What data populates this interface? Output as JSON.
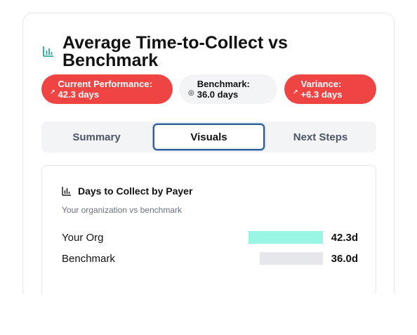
{
  "header": {
    "title": "Average Time-to-Collect vs Benchmark",
    "icon": "bar-chart-icon",
    "icon_color": "#0f9d8a"
  },
  "badges": [
    {
      "icon": "trending-up-icon",
      "glyph": "↗",
      "line1": "Current Performance:",
      "line2": "42.3 days",
      "color": "#ef4444"
    },
    {
      "icon": "target-icon",
      "glyph": "◎",
      "line1": "Benchmark:",
      "line2": "36.0 days",
      "color": "#f3f4f6"
    },
    {
      "icon": "trending-up-icon",
      "glyph": "↗",
      "line1": "Variance:",
      "line2": "+6.3 days",
      "color": "#ef4444"
    }
  ],
  "tabs": [
    {
      "label": "Summary",
      "active": false
    },
    {
      "label": "Visuals",
      "active": true
    },
    {
      "label": "Next Steps",
      "active": false
    }
  ],
  "panel": {
    "icon": "bar-chart-icon",
    "title": "Days to Collect by Payer",
    "subtitle": "Your organization vs benchmark",
    "rows": [
      {
        "label": "Your Org",
        "value": 42.3,
        "value_text": "42.3d",
        "color": "#99f6e4"
      },
      {
        "label": "Benchmark",
        "value": 36.0,
        "value_text": "36.0d",
        "color": "#e5e7eb"
      }
    ]
  }
}
